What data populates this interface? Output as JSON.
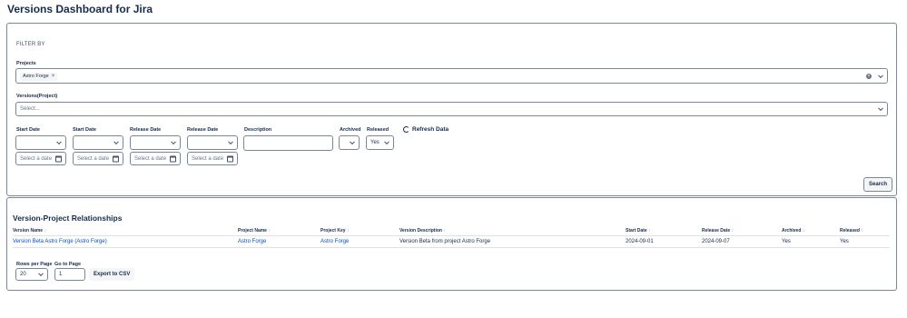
{
  "page": {
    "title": "Versions Dashboard for Jira"
  },
  "filters": {
    "heading": "FILTER BY",
    "projects": {
      "label": "Projects",
      "selected": [
        "Astro Forge"
      ]
    },
    "versions": {
      "label": "Versions(Project)",
      "placeholder": "Select..."
    },
    "start_date_1": {
      "label": "Start Date",
      "placeholder": "Select a date"
    },
    "start_date_2": {
      "label": "Start Date",
      "placeholder": "Select a date"
    },
    "release_date_1": {
      "label": "Release Date",
      "placeholder": "Select a date"
    },
    "release_date_2": {
      "label": "Release Date",
      "placeholder": "Select a date"
    },
    "description": {
      "label": "Description",
      "value": ""
    },
    "archived": {
      "label": "Archived",
      "value": ""
    },
    "released": {
      "label": "Released",
      "value": "Yes"
    },
    "refresh_label": "Refresh Data",
    "search_label": "Search"
  },
  "results": {
    "title": "Version-Project Relationships",
    "columns": [
      "Version Name",
      "Project Name",
      "Project Key",
      "Version Description",
      "Start Date",
      "Release Date",
      "Archived",
      "Released"
    ],
    "rows": [
      [
        "Version Beta Astro Forge (Astro Forge)",
        "Astro Forge",
        "Astro Forge",
        "Version Beta from project Astro Forge",
        "2024-09-01",
        "2024-09-07",
        "Yes",
        "Yes"
      ]
    ],
    "sort_glyph": "↕"
  },
  "pagination": {
    "rows_per_page_label": "Rows per Page",
    "rows_per_page_value": "20",
    "go_to_page_label": "Go to Page",
    "go_to_page_value": "1",
    "export_label": "Export to CSV"
  },
  "colors": {
    "link": "#0052cc",
    "border": "#7a869a",
    "text": "#172b4d"
  }
}
